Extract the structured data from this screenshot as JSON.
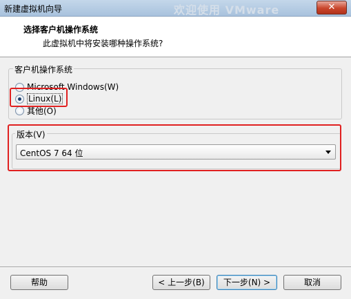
{
  "window": {
    "title": "新建虚拟机向导",
    "background_text": "欢迎使用 VMware",
    "close_label": "✕"
  },
  "header": {
    "title": "选择客户机操作系统",
    "subtitle": "此虚拟机中将安装哪种操作系统?"
  },
  "os_group": {
    "label": "客户机操作系统",
    "options": [
      {
        "label": "Microsoft Windows(W)",
        "checked": false
      },
      {
        "label": "Linux(L)",
        "checked": true
      },
      {
        "label": "其他(O)",
        "checked": false
      }
    ]
  },
  "version_group": {
    "label": "版本(V)",
    "selected": "CentOS 7 64 位"
  },
  "buttons": {
    "help": "帮助",
    "back": "< 上一步(B)",
    "next": "下一步(N) >",
    "cancel": "取消"
  },
  "colors": {
    "highlight": "#e02020",
    "title_bar": "#b9cfe6",
    "close_button": "#c9462c"
  }
}
